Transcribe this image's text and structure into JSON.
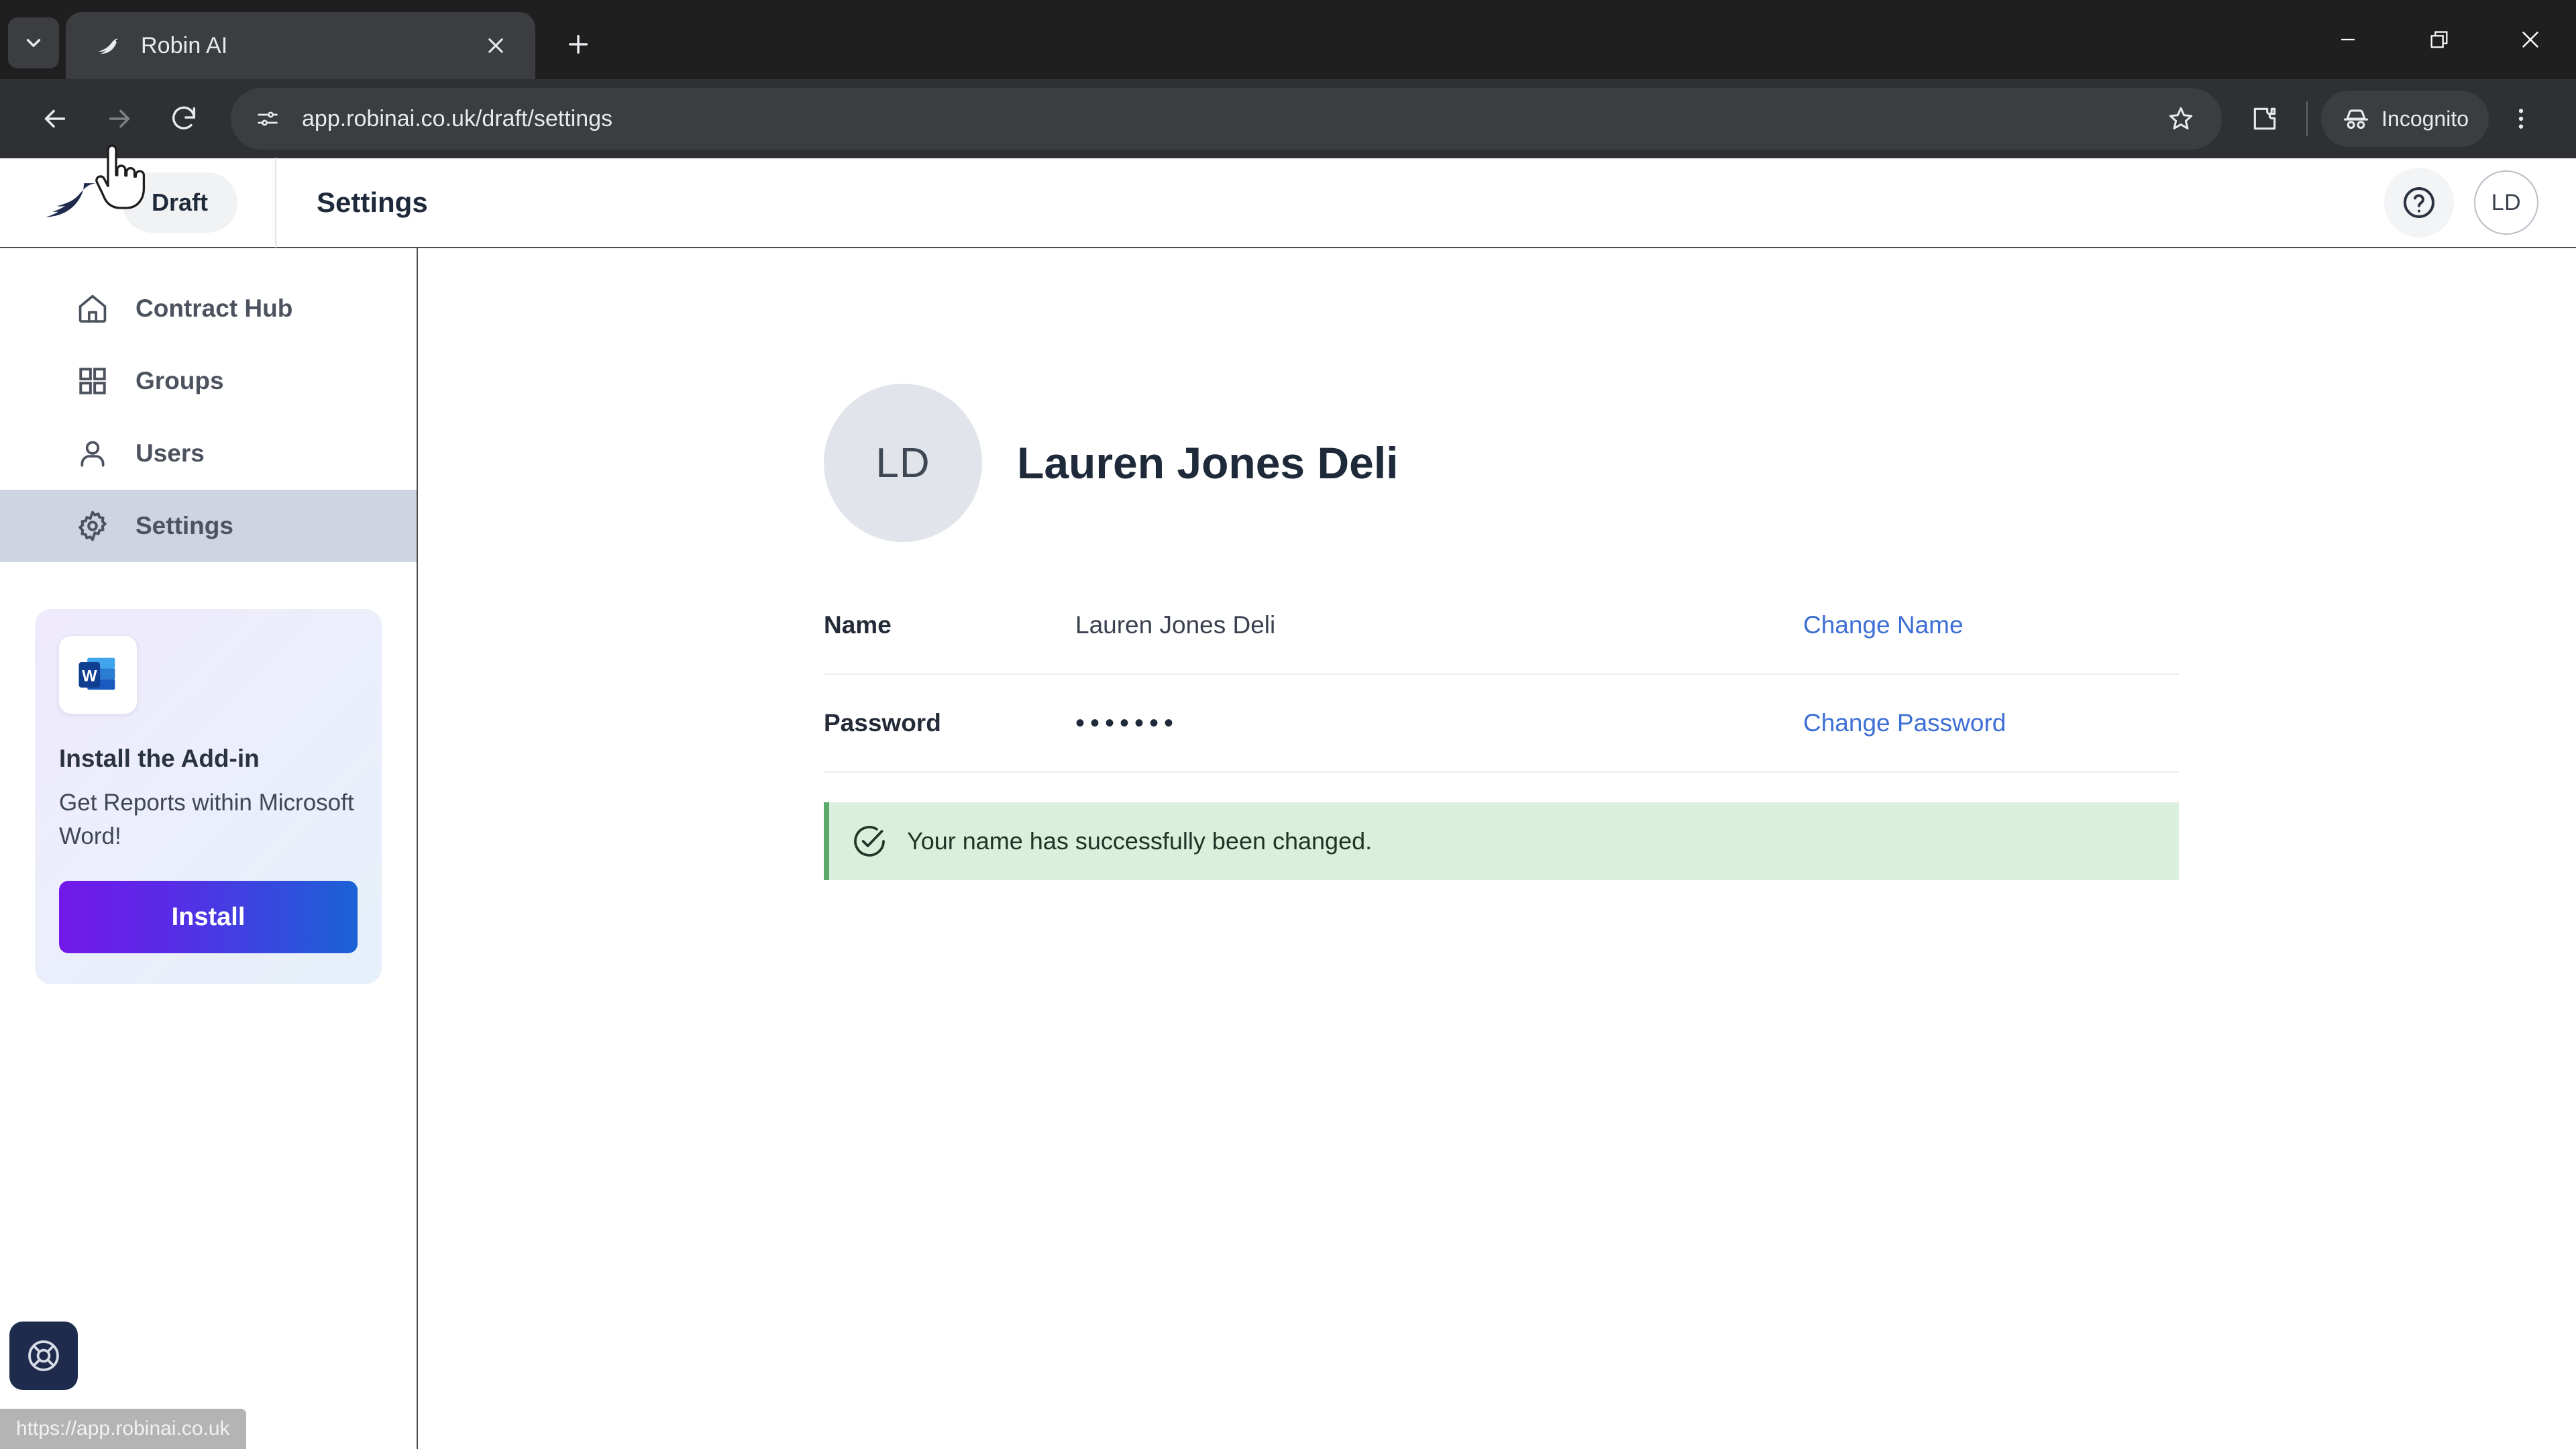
{
  "browser": {
    "tab": {
      "title": "Robin AI",
      "favicon_icon": "robin-bird-favicon",
      "close_icon": "close-icon"
    },
    "tab_list_icon": "chevron-down-icon",
    "new_tab_icon": "plus-icon",
    "window_controls": {
      "minimize_icon": "minimize-icon",
      "maximize_icon": "restore-icon",
      "close_icon": "window-close-icon"
    },
    "toolbar": {
      "back_icon": "back-arrow-icon",
      "forward_icon": "forward-arrow-icon",
      "reload_icon": "reload-icon",
      "site_info_icon": "site-settings-icon",
      "url": "app.robinai.co.uk/draft/settings",
      "bookmark_icon": "star-icon",
      "extensions_icon": "extensions-puzzle-icon",
      "incognito_icon": "incognito-hat-icon",
      "incognito_label": "Incognito",
      "menu_icon": "three-dot-menu-icon"
    },
    "status_url": "https://app.robinai.co.uk"
  },
  "app_header": {
    "logo_icon": "robin-bird-logo",
    "draft_label": "Draft",
    "page_title": "Settings",
    "help_icon": "question-circle-icon",
    "avatar_initials": "LD"
  },
  "sidebar": {
    "items": [
      {
        "label": "Contract Hub",
        "icon": "home-icon",
        "active": false
      },
      {
        "label": "Groups",
        "icon": "grid-squares-icon",
        "active": false
      },
      {
        "label": "Users",
        "icon": "user-icon",
        "active": false
      },
      {
        "label": "Settings",
        "icon": "gear-icon",
        "active": true
      }
    ],
    "addin_card": {
      "app_icon": "microsoft-word-icon",
      "title": "Install the Add-in",
      "subtitle": "Get Reports within Microsoft Word!",
      "button_label": "Install",
      "button_gradient_from": "#7318e8",
      "button_gradient_to": "#1a62d6"
    },
    "help_fab_icon": "lifebuoy-icon"
  },
  "main": {
    "profile": {
      "avatar_initials": "LD",
      "name": "Lauren Jones Deli"
    },
    "rows": [
      {
        "label": "Name",
        "value": "Lauren Jones Deli",
        "action": "Change Name"
      },
      {
        "label": "Password",
        "value": "•••••••",
        "action": "Change Password"
      }
    ],
    "alert": {
      "icon": "check-circle-icon",
      "message": "Your name has successfully been changed.",
      "background": "#daf0dd",
      "accent": "#5aa86a"
    }
  },
  "colors": {
    "link": "#3e6fd4",
    "sidebar_active": "#ced4e1",
    "chrome_dark": "#1f1f1f",
    "toolbar_dark": "#2f3033"
  }
}
